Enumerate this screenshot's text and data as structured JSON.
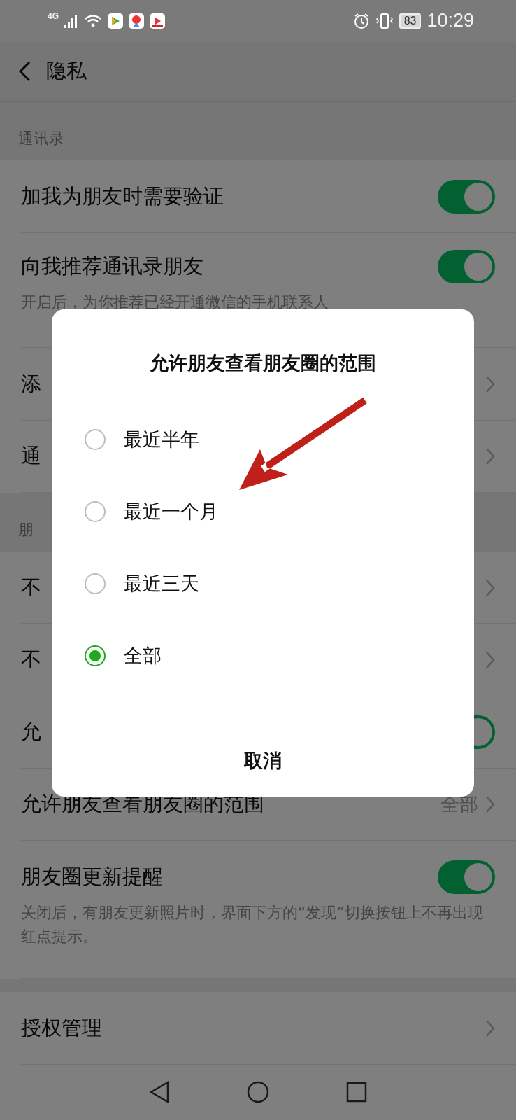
{
  "status_bar": {
    "network": "4G",
    "battery": "83",
    "time": "10:29"
  },
  "header": {
    "title": "隐私"
  },
  "sections": [
    {
      "label": "通讯录",
      "rows": [
        {
          "kind": "toggle",
          "title": "加我为朋友时需要验证",
          "on": true
        },
        {
          "kind": "toggle",
          "title": "向我推荐通讯录朋友",
          "on": true,
          "description": "开启后，为你推荐已经开通微信的手机联系人"
        },
        {
          "kind": "link",
          "title": "添"
        },
        {
          "kind": "link",
          "title": "通"
        }
      ]
    },
    {
      "label": "朋",
      "rows": [
        {
          "kind": "link",
          "title": "不"
        },
        {
          "kind": "link",
          "title": "不"
        },
        {
          "kind": "toggle",
          "title": "允",
          "on": true
        },
        {
          "kind": "link",
          "title": "允许朋友查看朋友圈的范围",
          "value": "全部"
        },
        {
          "kind": "toggle",
          "title": "朋友圈更新提醒",
          "on": true,
          "description": "关闭后，有朋友更新照片时，界面下方的“发现”切换按钮上不再出现红点提示。"
        }
      ]
    },
    {
      "rows": [
        {
          "kind": "link",
          "title": "授权管理"
        }
      ]
    }
  ],
  "dialog": {
    "title": "允许朋友查看朋友圈的范围",
    "options": [
      {
        "label": "最近半年",
        "selected": false
      },
      {
        "label": "最近一个月",
        "selected": false
      },
      {
        "label": "最近三天",
        "selected": false
      },
      {
        "label": "全部",
        "selected": true
      }
    ],
    "cancel": "取消"
  }
}
